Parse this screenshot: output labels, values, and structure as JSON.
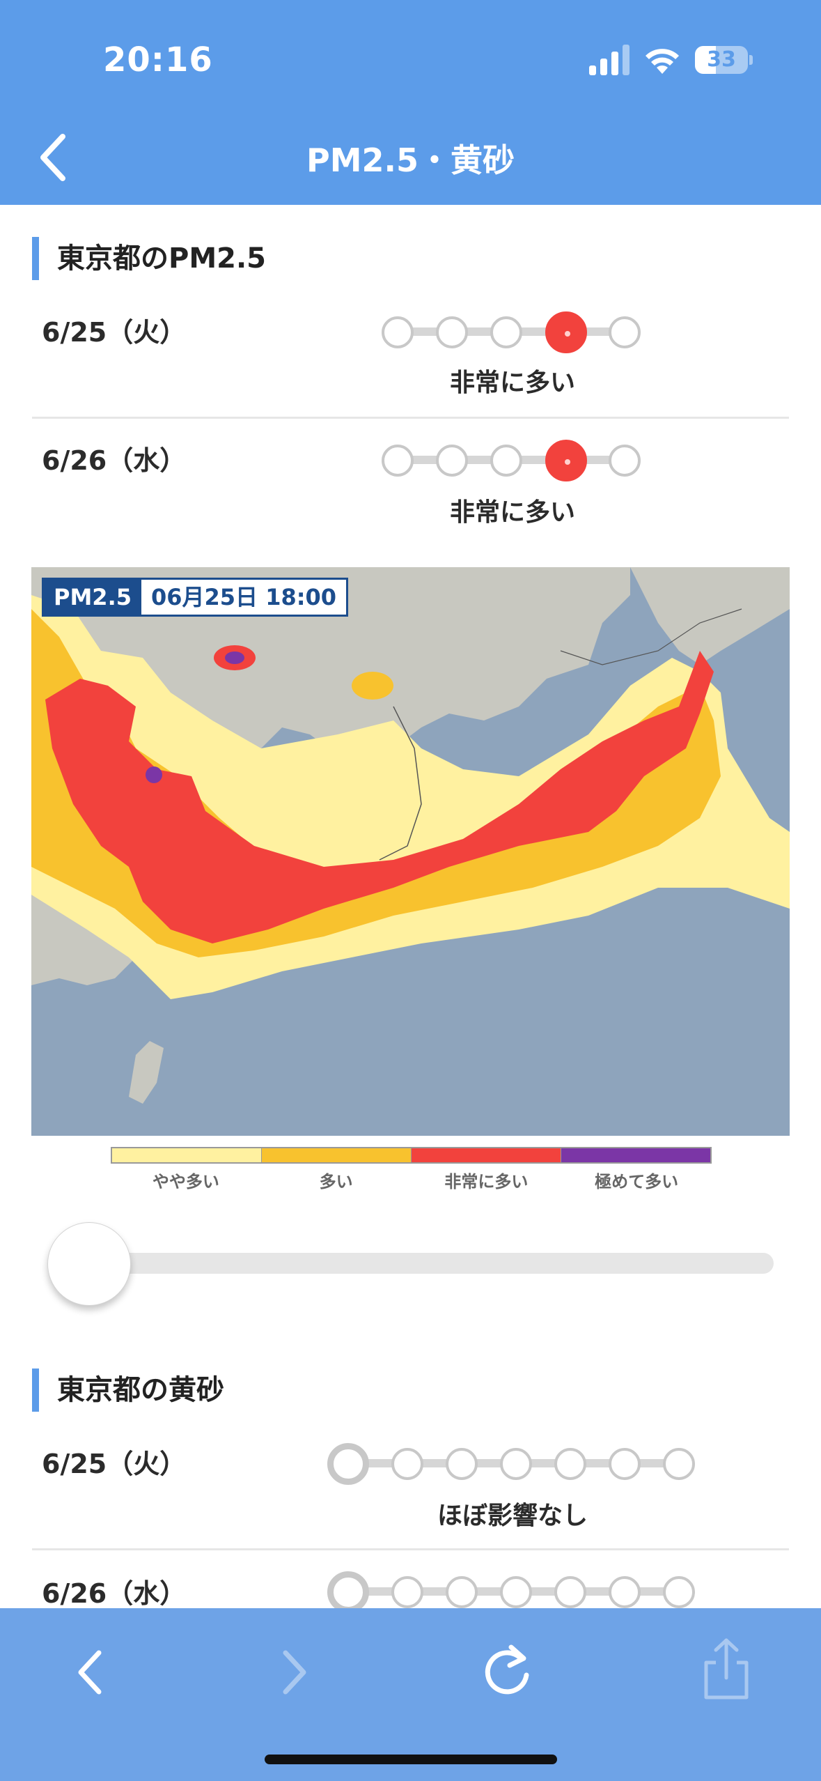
{
  "status_bar": {
    "time": "20:16",
    "battery": "33"
  },
  "header": {
    "title": "PM2.5・黄砂"
  },
  "pm25": {
    "heading": "東京都のPM2.5",
    "rows": [
      {
        "date": "6/25（火）",
        "level_label": "非常に多い",
        "level": 4,
        "levels_total": 5
      },
      {
        "date": "6/26（水）",
        "level_label": "非常に多い",
        "level": 4,
        "levels_total": 5
      }
    ]
  },
  "map": {
    "badge_label": "PM2.5",
    "badge_time": "06月25日 18:00",
    "legend": [
      {
        "label": "やや多い",
        "color": "#fff1a0"
      },
      {
        "label": "多い",
        "color": "#f8c22e"
      },
      {
        "label": "非常に多い",
        "color": "#f2423d"
      },
      {
        "label": "極めて多い",
        "color": "#7b36a6"
      }
    ],
    "slider_position": 0
  },
  "kosa": {
    "heading": "東京都の黄砂",
    "rows": [
      {
        "date": "6/25（火）",
        "level_label": "ほぼ影響なし",
        "level": 1,
        "levels_total": 7
      },
      {
        "date": "6/26（水）",
        "level_label": "",
        "level": 1,
        "levels_total": 7
      }
    ]
  },
  "colors": {
    "header": "#5c9ce9",
    "toolbar": "#6ea3e7",
    "accent_red": "#f2423d"
  },
  "toolbar": {
    "icons": [
      "chevron-left-icon",
      "chevron-right-icon",
      "reload-icon",
      "share-icon"
    ]
  }
}
